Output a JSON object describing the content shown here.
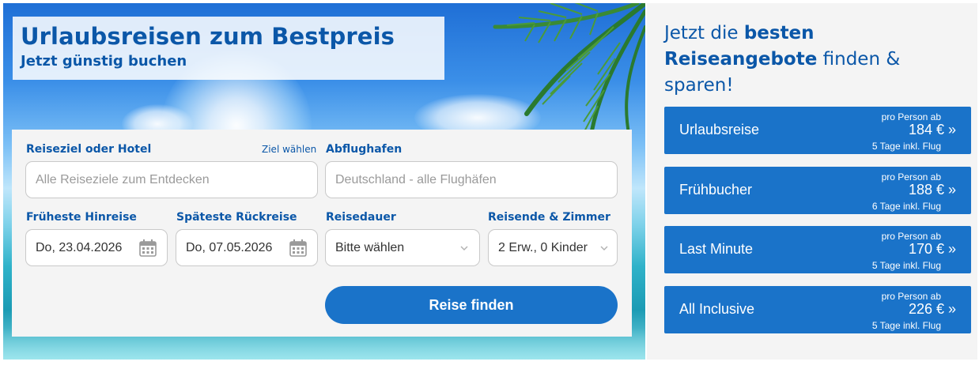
{
  "hero": {
    "title": "Urlaubsreisen zum Bestpreis",
    "subtitle": "Jetzt günstig buchen"
  },
  "search": {
    "destination_label": "Reiseziel oder Hotel",
    "destination_link": "Ziel wählen",
    "destination_placeholder": "Alle Reiseziele zum Entdecken",
    "airport_label": "Abflughafen",
    "airport_placeholder": "Deutschland - alle Flughäfen",
    "departure_label": "Früheste Hinreise",
    "departure_value": "Do, 23.04.2026",
    "return_label": "Späteste Rückreise",
    "return_value": "Do, 07.05.2026",
    "duration_label": "Reisedauer",
    "duration_value": "Bitte wählen",
    "travelers_label": "Reisende & Zimmer",
    "travelers_value": "2 Erw., 0 Kinder",
    "submit_label": "Reise finden"
  },
  "panel": {
    "heading_pre": "Jetzt die ",
    "heading_bold": "besten Reiseangebote",
    "heading_post": " finden & sparen!",
    "deals": [
      {
        "name": "Urlaubsreise",
        "per_person": "pro Person ab",
        "price": "184 € »",
        "duration": "5 Tage inkl. Flug"
      },
      {
        "name": "Frühbucher",
        "per_person": "pro Person ab",
        "price": "188 € »",
        "duration": "6 Tage inkl. Flug"
      },
      {
        "name": "Last Minute",
        "per_person": "pro Person ab",
        "price": "170 € »",
        "duration": "5 Tage inkl. Flug"
      },
      {
        "name": "All Inclusive",
        "per_person": "pro Person ab",
        "price": "226 € »",
        "duration": "5 Tage inkl. Flug"
      }
    ]
  },
  "colors": {
    "brand": "#0b57a8",
    "button": "#1a73c9",
    "panel_bg": "#f4f4f4"
  },
  "icons": [
    "calendar-icon",
    "chevron-down-icon",
    "palm-tree-image"
  ]
}
